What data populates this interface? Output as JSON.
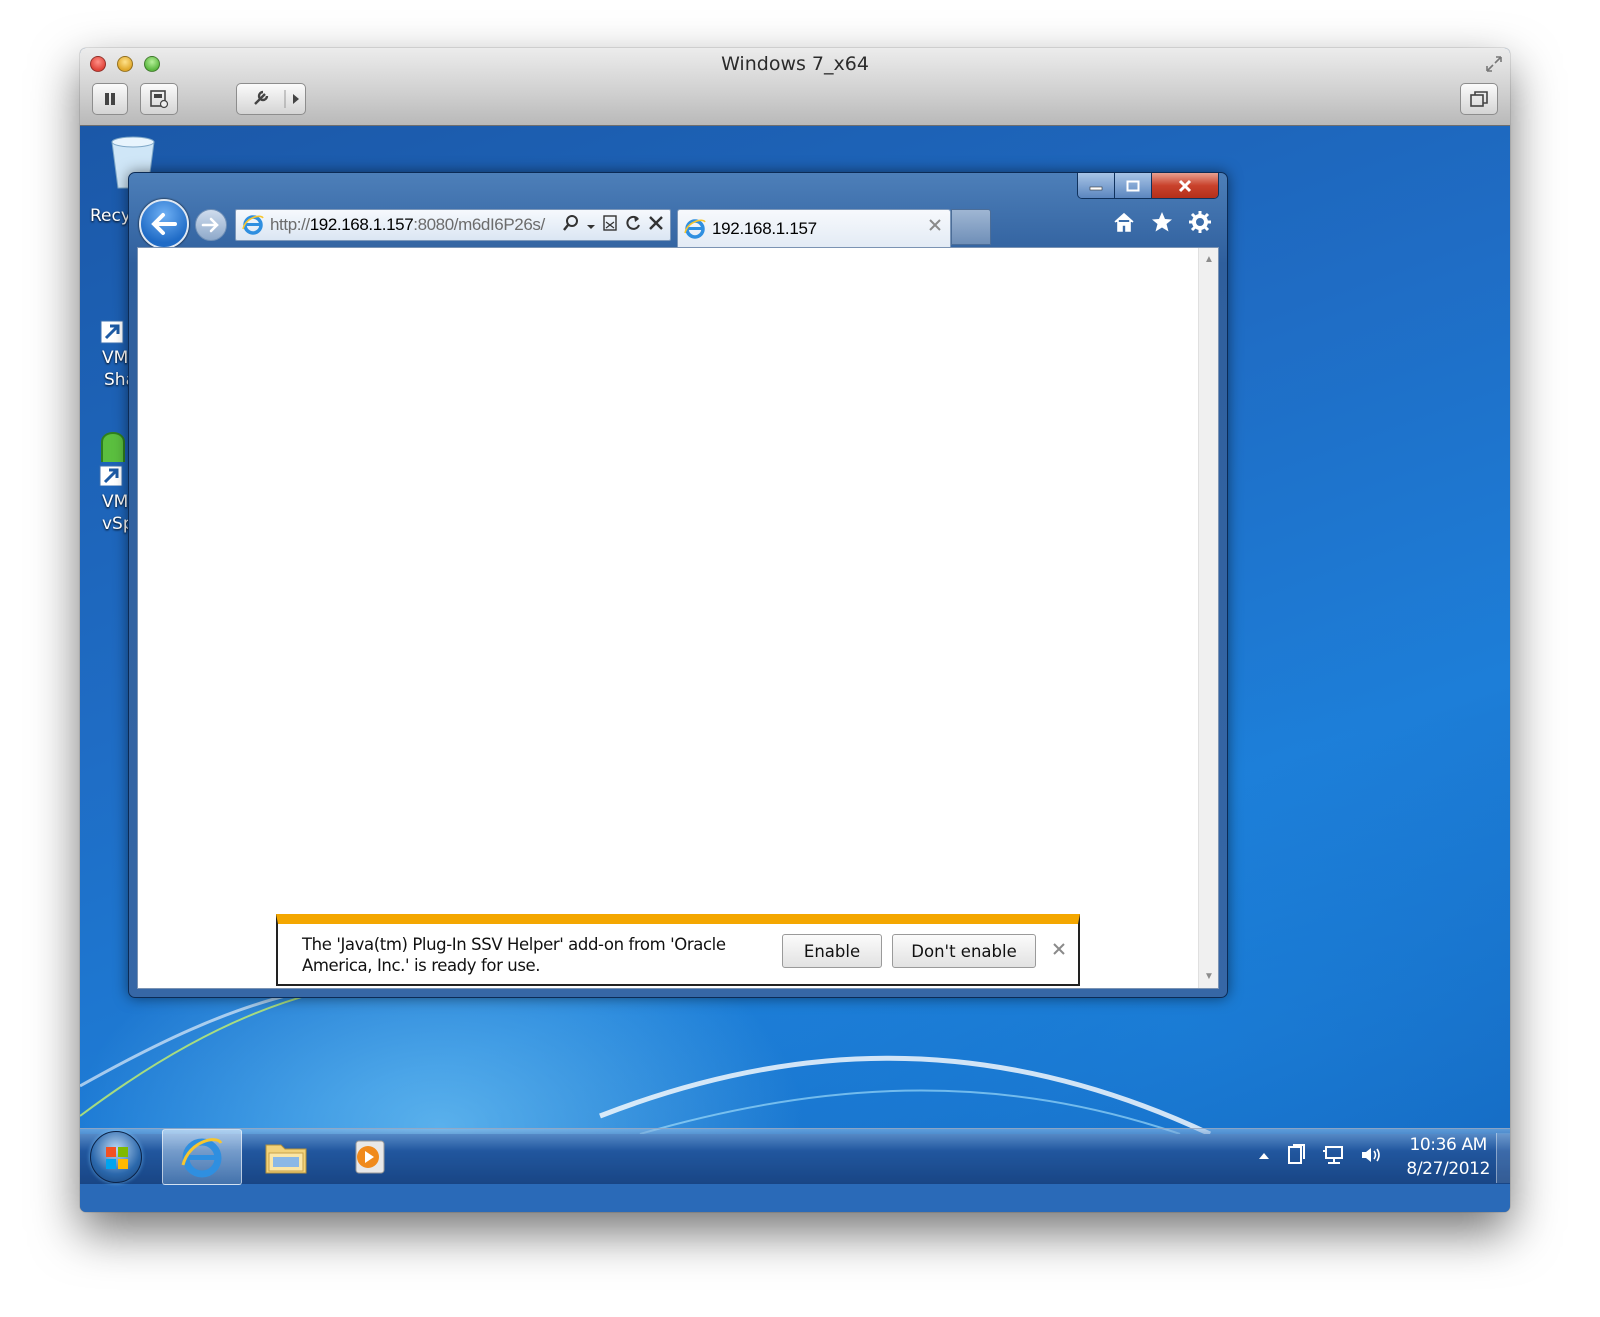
{
  "mac_window": {
    "title": "Windows 7_x64",
    "toolbar": [
      "pause",
      "snapshot",
      "settings",
      "restore"
    ]
  },
  "desktop": {
    "icons": [
      {
        "label": "Recy",
        "icon": "recycle-bin-icon"
      },
      {
        "label_line1": "VM",
        "label_line2": "Sha",
        "icon": "vmware-shared-folders-icon"
      },
      {
        "label_line1": "VM",
        "label_line2": "vSp",
        "icon": "vmware-vsphere-icon"
      }
    ]
  },
  "ie": {
    "url_prefix": "http://",
    "url_host": "192.168.1.157",
    "url_rest": ":8080/m6dI6P26s/",
    "tab_title": "192.168.1.157",
    "toolbar_icons": [
      "home-icon",
      "favorites-star-icon",
      "tools-gear-icon"
    ]
  },
  "notification": {
    "message": "The 'Java(tm) Plug-In SSV Helper' add-on from 'Oracle America, Inc.' is ready for use.",
    "enable_label": "Enable",
    "dont_enable_label": "Don't enable",
    "accent_color": "#f4a700"
  },
  "taskbar": {
    "pinned": [
      "internet-explorer-icon",
      "windows-explorer-icon",
      "media-player-icon"
    ],
    "time": "10:36 AM",
    "date": "8/27/2012"
  }
}
